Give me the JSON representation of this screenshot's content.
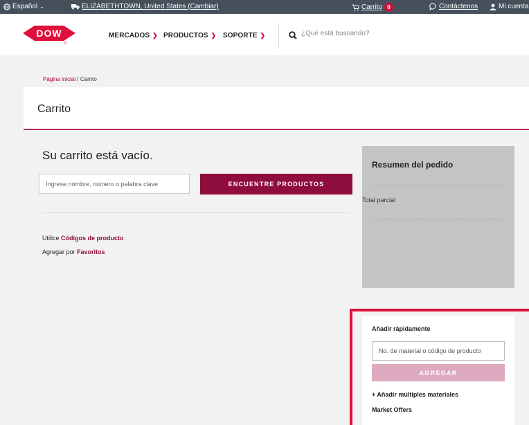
{
  "topbar": {
    "language": "Español",
    "location": "ELIZABETHTOWN, United States (Cambiar)",
    "cart_label": "Carrito",
    "cart_count": "0",
    "contact": "Contáctenos",
    "account": "Mi cuenta"
  },
  "header": {
    "logo_text": "DOW",
    "nav": [
      {
        "label": "MERCADOS"
      },
      {
        "label": "PRODUCTOS"
      },
      {
        "label": "SOPORTE"
      }
    ],
    "search_placeholder": "¿Qué está buscando?"
  },
  "breadcrumb": {
    "home": "Página inicial",
    "separator": "/",
    "current": "Carrito"
  },
  "page_title": "Carrito",
  "cart": {
    "empty_message": "Su carrito está vacío.",
    "find_placeholder": "Ingrese nombre, número o palabra clave",
    "find_button": "ENCUENTRE PRODUCTOS",
    "use_prefix": "Utilice",
    "product_codes_link": "Códigos de producto",
    "add_by_prefix": "Agregar por",
    "favorites_link": "Favoritos"
  },
  "summary": {
    "title": "Resumen del pedido",
    "subtotal_label": "Total parcial"
  },
  "quick_add": {
    "title": "Añadir rápidamente",
    "input_placeholder": "No. de material o código de producto",
    "add_button": "AGREGAR",
    "multiple_link": "+ Añadir múltiples materiales",
    "market_offers": "Market Offers"
  },
  "colors": {
    "brand_red": "#e0103d",
    "accent_maroon": "#8e0d3c",
    "topbar_bg": "#45505b",
    "summary_bg": "#c4c4c4",
    "disabled_button": "#deaac0"
  }
}
